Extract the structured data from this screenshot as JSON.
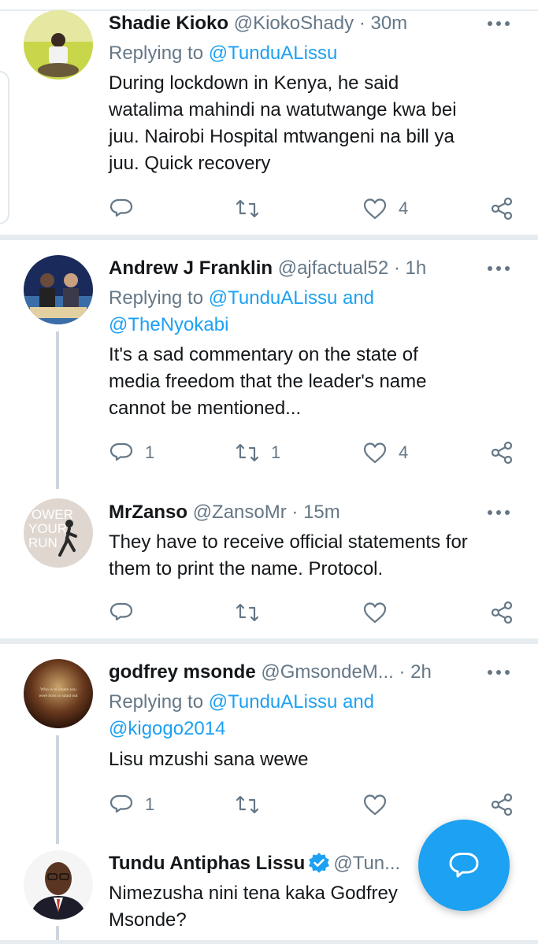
{
  "tweets": [
    {
      "name": "Shadie Kioko",
      "handle": "@KiokoShady",
      "time": "30m",
      "reply_prefix": "Replying to ",
      "reply_links": [
        "@TunduALissu"
      ],
      "body": [
        "During lockdown in Kenya, he said",
        "watalima mahindi na watutwange kwa bei",
        "juu. Nairobi Hospital mtwangeni na bill ya",
        "juu.  Quick recovery"
      ],
      "replies": "",
      "retweets": "",
      "likes": "4"
    },
    {
      "name": "Andrew J Franklin",
      "handle": "@ajfactual52",
      "time": "1h",
      "reply_prefix": "Replying to ",
      "reply_links": [
        "@TunduALissu",
        "@TheNyokabi"
      ],
      "reply_joiner": " and",
      "body": [
        "It's a sad commentary on the state of",
        "media freedom that the leader's name",
        "cannot be mentioned..."
      ],
      "replies": "1",
      "retweets": "1",
      "likes": "4"
    },
    {
      "name": "MrZanso",
      "handle": "@ZansoMr",
      "time": "15m",
      "body": [
        "They have to receive official statements for",
        "them to print the name. Protocol."
      ],
      "replies": "",
      "retweets": "",
      "likes": "",
      "avatar_text": [
        "OWER",
        "YOUR",
        "RUN"
      ]
    },
    {
      "name": "godfrey msonde",
      "handle": "@GmsondeM...",
      "time": "2h",
      "reply_prefix": "Replying to ",
      "reply_links": [
        "@TunduALissu",
        "@kigogo2014"
      ],
      "reply_joiner": " and",
      "body": [
        "Lisu mzushi sana wewe"
      ],
      "replies": "1",
      "retweets": "",
      "likes": "",
      "avatar_text": [
        "Who is to where you",
        "were born to stand out"
      ]
    },
    {
      "name": "Tundu Antiphas Lissu",
      "handle": "@Tun...",
      "verified": true,
      "body": [
        "Nimezusha nini tena kaka Godfrey",
        "Msonde?"
      ]
    }
  ],
  "time_separator": " · ",
  "icons": [
    "reply-icon",
    "retweet-icon",
    "like-icon",
    "share-icon",
    "more-icon",
    "verified-icon",
    "compose-reply-icon"
  ],
  "colors": {
    "accent": "#1da1f2",
    "muted": "#657786",
    "separator": "#e6ecf0",
    "text": "#14171a"
  }
}
